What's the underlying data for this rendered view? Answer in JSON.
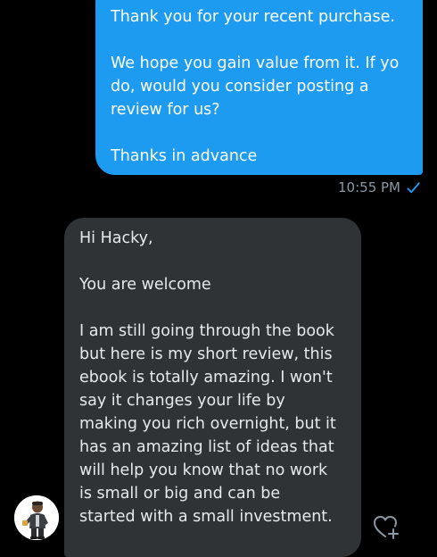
{
  "conversation": {
    "sent_message": {
      "paragraphs": [
        "Thank you for your recent purchase.",
        "We hope you gain value from it. If yo\ndo, would you consider posting a\nreview for us?",
        "Thanks in advance"
      ],
      "time": "10:55 PM",
      "status_icon": "check-icon"
    },
    "received_message": {
      "paragraphs": [
        "Hi Hacky,",
        "You are welcome",
        "I am still going through the book\nbut here is my short review, this\nebook is totally amazing. I won't\nsay it changes your life by\nmaking you rich overnight, but it\nhas an amazing list of ideas that\nwill help you know that no work\nis small or big and can be\nstarted with a small investment."
      ],
      "sender_avatar_icon": "avatar-icon",
      "react_icon": "heart-add-icon"
    }
  },
  "colors": {
    "background": "#000000",
    "sent_bubble": "#1d9bf0",
    "received_bubble": "#2f3336",
    "received_text": "#e7e9ea",
    "meta_text": "#8b98a5",
    "check": "#1d9bf0"
  }
}
